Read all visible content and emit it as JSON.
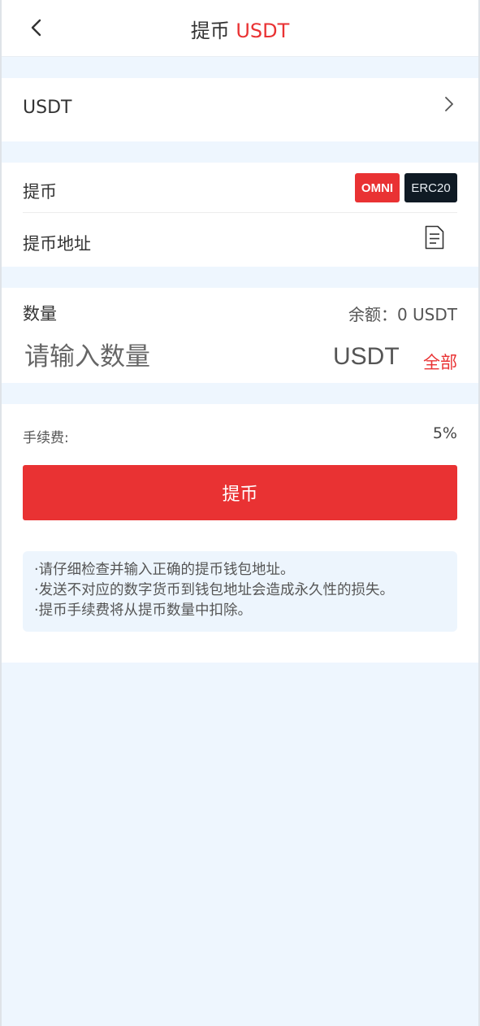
{
  "header": {
    "title_prefix": "提币",
    "title_accent": "USDT"
  },
  "coin_selector": {
    "label": "USDT"
  },
  "network": {
    "label": "提币",
    "options": [
      "OMNI",
      "ERC20"
    ],
    "selected": "OMNI",
    "address_label": "提币地址"
  },
  "amount": {
    "label": "数量",
    "balance": "余额：0 USDT",
    "input_placeholder": "请输入数量",
    "input_value": "",
    "unit": "USDT",
    "all_label": "全部"
  },
  "fee": {
    "label": "手续费:",
    "value": "5%"
  },
  "submit_label": "提币",
  "notices": [
    "·请仔细检查并输入正确的提币钱包地址。",
    "·发送不对应的数字货币到钱包地址会造成永久性的损失。",
    "·提币手续费将从提币数量中扣除。"
  ],
  "colors": {
    "accent": "#e93233",
    "dark_chip": "#0f1a24",
    "background": "#eef6fe"
  }
}
